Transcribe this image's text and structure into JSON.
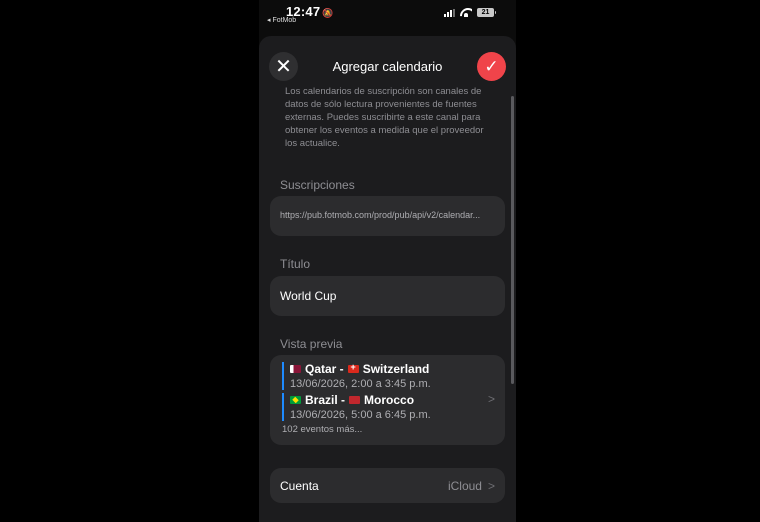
{
  "status_bar": {
    "time": "12:47",
    "back_app": "◂ FotMob",
    "battery": "21"
  },
  "header": {
    "title": "Agregar calendario",
    "close_glyph": "✕",
    "confirm_glyph": "✓"
  },
  "description": "Los calendarios de suscripción son canales de datos de sólo lectura provenientes de fuentes externas. Puedes suscribirte a este canal para obtener los eventos a medida que el proveedor los actualice.",
  "subscriptions": {
    "label": "Suscripciones",
    "url": "https://pub.fotmob.com/prod/pub/api/v2/calendar..."
  },
  "title_section": {
    "label": "Título",
    "value": "World Cup"
  },
  "preview": {
    "label": "Vista previa",
    "events": [
      {
        "home": "Qatar -",
        "away": "Switzerland",
        "home_flag": "qatar-flag-icon",
        "away_flag": "switzerland-flag-icon",
        "date": "13/06/2026, 2:00 a 3:45 p.m."
      },
      {
        "home": "Brazil -",
        "away": "Morocco",
        "home_flag": "brazil-flag-icon",
        "away_flag": "morocco-flag-icon",
        "date": "13/06/2026, 5:00 a 6:45 p.m."
      }
    ],
    "more": "102 eventos más..."
  },
  "account": {
    "label": "Cuenta",
    "value": "iCloud"
  },
  "colors": {
    "accent": "#f0444a",
    "event_bar": "#1e8bff",
    "sheet_bg": "#1c1c1e",
    "card_bg": "#2c2c2e"
  }
}
